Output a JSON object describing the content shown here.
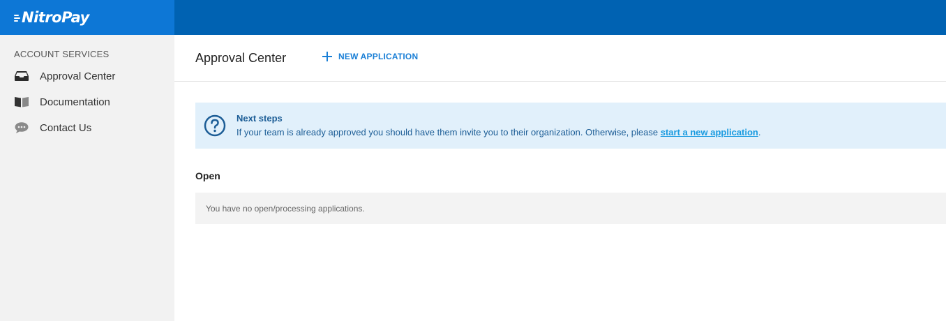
{
  "brand": {
    "name": "NitroPay",
    "colors": {
      "topbar": "#0062b2",
      "logo_bg": "#0d77d6",
      "accent": "#1a7fd6",
      "notice_bg": "#e1f0fb",
      "notice_text": "#1c5d96"
    }
  },
  "sidebar": {
    "heading": "ACCOUNT SERVICES",
    "items": [
      {
        "label": "Approval Center",
        "icon": "inbox-icon"
      },
      {
        "label": "Documentation",
        "icon": "book-icon"
      },
      {
        "label": "Contact Us",
        "icon": "chat-bubble-icon"
      }
    ]
  },
  "header": {
    "title": "Approval Center",
    "new_application_label": "NEW APPLICATION",
    "new_application_icon": "plus-icon"
  },
  "notice": {
    "icon": "question-circle-icon",
    "title": "Next steps",
    "body_prefix": "If your team is already approved you should have them invite you to their organization. Otherwise, please ",
    "link_text": "start a new application",
    "body_suffix": "."
  },
  "open_section": {
    "title": "Open",
    "empty_message": "You have no open/processing applications."
  }
}
